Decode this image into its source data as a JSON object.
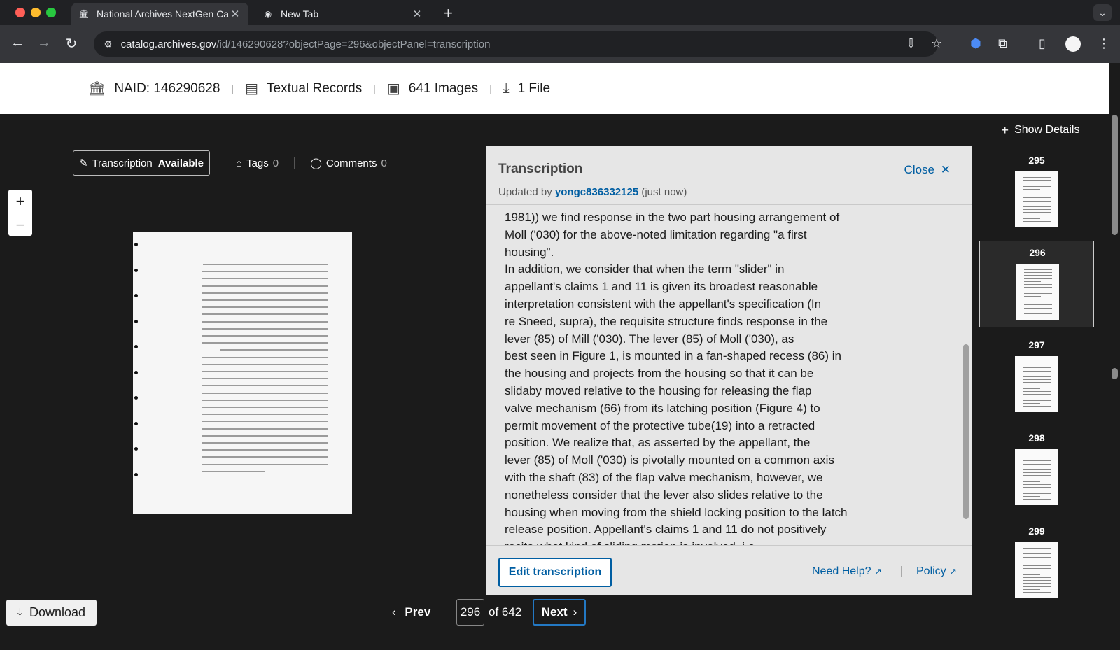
{
  "browser": {
    "tabs": [
      {
        "title": "National Archives NextGen Ca",
        "favicon": "archives-icon",
        "active": true
      },
      {
        "title": "New Tab",
        "favicon": "chrome-icon",
        "active": false
      }
    ],
    "url_host": "catalog.archives.gov",
    "url_path": "/id/146290628?objectPage=296&objectPanel=transcription"
  },
  "record": {
    "naid": "NAID: 146290628",
    "type": "Textual Records",
    "images": "641 Images",
    "files": "1 File"
  },
  "details": {
    "label": "Show Details"
  },
  "tools": {
    "transcription_label": "Transcription",
    "transcription_status": "Available",
    "tags_label": "Tags",
    "tags_count": "0",
    "comments_label": "Comments",
    "comments_count": "0"
  },
  "zoom": {
    "in": "+",
    "out": "−"
  },
  "transcription": {
    "title": "Transcription",
    "updated_prefix": "Updated by",
    "user": "yongc836332125",
    "updated_suffix": "(just now)",
    "close_label": "Close",
    "lines": [
      "1981)) we find response in the two part housing arrangement of",
      "Moll ('030) for the above-noted limitation regarding \"a first",
      "housing\".",
      "In addition, we consider that when the term \"slider\" in",
      "appellant's claims 1 and 11 is given its broadest reasonable",
      "interpretation consistent with the appellant's specification (In",
      "re Sneed, supra), the requisite structure finds response in the",
      "lever (85) of Mill ('030). The lever (85) of Moll ('030), as",
      "best seen in Figure 1, is mounted in a fan-shaped recess (86) in",
      "the housing and projects from the housing so that it can be",
      "slidaby moved relative to the housing for releasing the flap",
      "valve mechanism (66) from its latching position (Figure 4) to",
      "permit movement of the protective tube(19) into a retracted",
      "position. We realize that, as asserted by the appellant, the",
      "lever (85) of Moll ('030) is pivotally mounted on a common axis",
      "with the shaft (83) of the flap valve mechanism, however, we",
      "nonetheless consider that the lever also slides relative to the",
      "housing when moving from the shield locking position to the latch",
      "release position. Appellant's claims 1 and 11 do not positively",
      "recite what kind of sliding motion is involved, i.e."
    ],
    "edit_label": "Edit transcription",
    "help_label": "Need Help?",
    "policy_label": "Policy"
  },
  "pager": {
    "download_label": "Download",
    "prev_label": "Prev",
    "current_page": "296",
    "total_label": "of 642",
    "next_label": "Next"
  },
  "thumbnails": [
    {
      "page": "295"
    },
    {
      "page": "296"
    },
    {
      "page": "297"
    },
    {
      "page": "298"
    },
    {
      "page": "299"
    }
  ]
}
